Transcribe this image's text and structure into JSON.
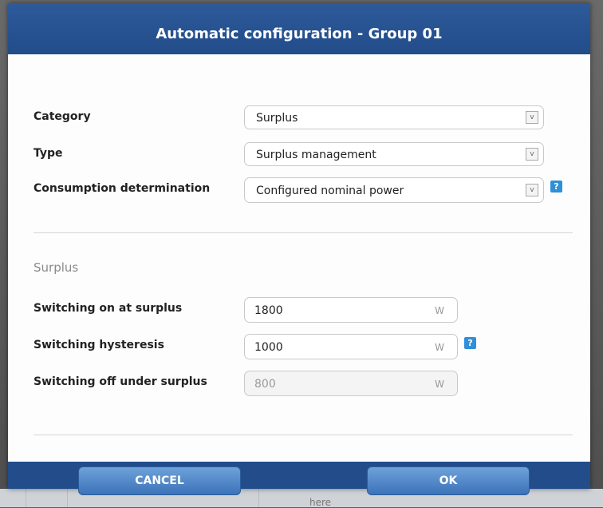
{
  "dialog": {
    "title": "Automatic configuration - Group 01"
  },
  "fields": {
    "category": {
      "label": "Category",
      "value": "Surplus"
    },
    "type": {
      "label": "Type",
      "value": "Surplus management"
    },
    "consumption": {
      "label": "Consumption determination",
      "value": "Configured nominal power"
    }
  },
  "surplus": {
    "section_title": "Surplus",
    "on": {
      "label": "Switching on at surplus",
      "value": "1800",
      "unit": "W"
    },
    "hysteresis": {
      "label": "Switching hysteresis",
      "value": "1000",
      "unit": "W"
    },
    "off": {
      "label": "Switching off under surplus",
      "value": "800",
      "unit": "W"
    }
  },
  "icons": {
    "help": "?",
    "dropdown": "v"
  },
  "buttons": {
    "cancel": "CANCEL",
    "ok": "OK"
  },
  "background": {
    "faint_text": "here"
  },
  "colors": {
    "header": "#224c8a",
    "button": "#4a82c8",
    "help": "#2f8fd8"
  }
}
